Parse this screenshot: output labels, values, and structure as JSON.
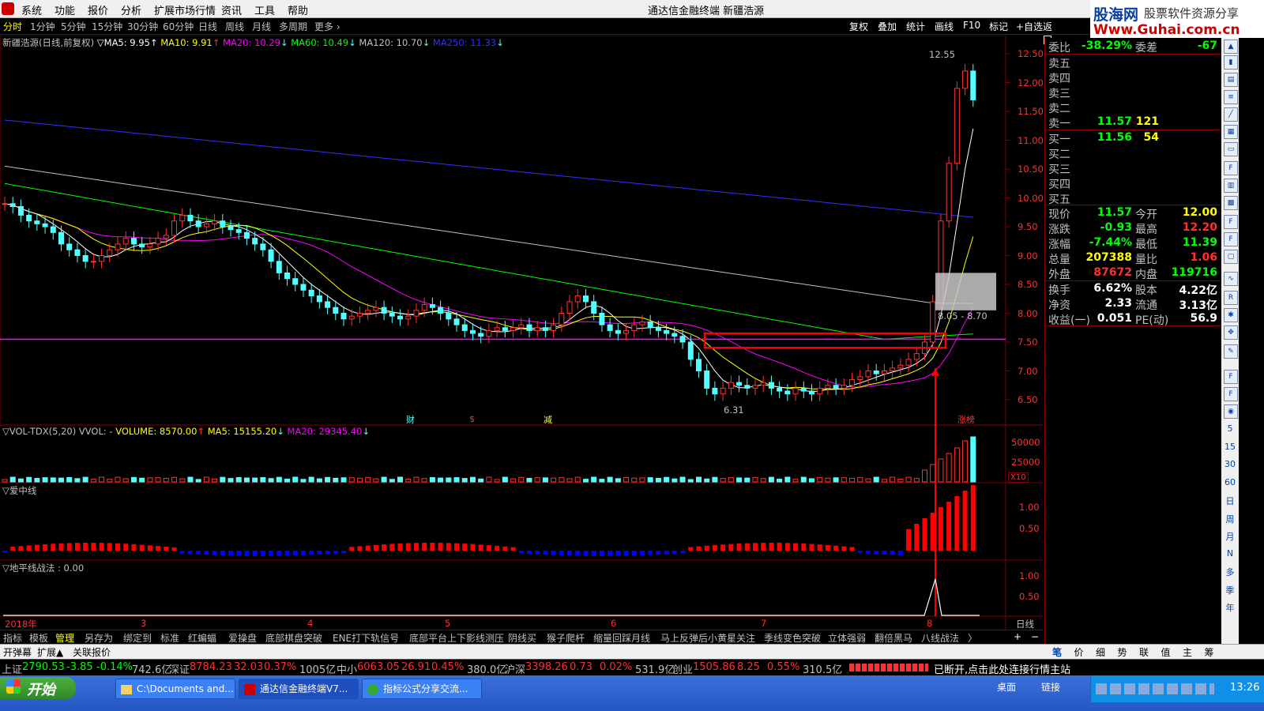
{
  "menu": {
    "items": [
      "系统",
      "功能",
      "报价",
      "分析",
      "扩展市场行情",
      "资讯",
      "工具",
      "帮助"
    ],
    "title": "通达信金融终端 新疆浩源"
  },
  "brand": {
    "name": "股海网",
    "slogan": "股票软件资源分享",
    "url": "Www.Guhai.com.cn"
  },
  "periods": [
    "分时",
    "1分钟",
    "5分钟",
    "15分钟",
    "30分钟",
    "60分钟",
    "日线",
    "周线",
    "月线",
    "多周期",
    "更多 ›"
  ],
  "right_buttons": [
    "复权",
    "叠加",
    "统计",
    "画线",
    "F10",
    "标记",
    "+自选",
    "返回"
  ],
  "main_legend": {
    "title": "新疆浩源(日线,前复权)",
    "ma5": "▽MA5: 9.95",
    "ma10": "MA10: 9.91",
    "ma20": "MA20: 10.29",
    "ma60": "MA60: 10.49",
    "ma120": "MA120: 10.70",
    "ma250": "MA250: 11.33"
  },
  "price_axis": [
    "12.50",
    "12.00",
    "11.50",
    "11.00",
    "10.50",
    "10.00",
    "9.50",
    "9.00",
    "8.50",
    "8.00",
    "7.50",
    "7.00",
    "6.50"
  ],
  "annotations": {
    "high": "12.55",
    "low": "6.31",
    "range": "8.05 - 8.70",
    "marks": [
      "财",
      "$",
      "减",
      "涨榜"
    ]
  },
  "vol_legend": {
    "name": "▽VOL-TDX(5,20)",
    "vvol": "VVOL: -",
    "volume": "VOLUME: 8570.00",
    "ma5": "MA5: 15155.20",
    "ma20": "MA20: 29345.40"
  },
  "vol_axis": [
    "50000",
    "25000"
  ],
  "vol_unit": "X10",
  "ind1": {
    "name": "▽爱中线",
    "axis": [
      "1.00",
      "0.50"
    ]
  },
  "ind2": {
    "name": "▽地平线战法 : 0.00",
    "axis": [
      "1.00",
      "0.50"
    ]
  },
  "date_axis": {
    "labels": [
      "2018年",
      "3",
      "4",
      "5",
      "6",
      "7",
      "8"
    ],
    "right": "日线"
  },
  "panel": {
    "weibi": {
      "label": "委比",
      "value": "-38.29%",
      "label2": "委差",
      "value2": "-67"
    },
    "sell": [
      {
        "label": "卖五"
      },
      {
        "label": "卖四"
      },
      {
        "label": "卖三"
      },
      {
        "label": "卖二"
      },
      {
        "label": "卖一",
        "price": "11.57",
        "vol": "121"
      }
    ],
    "buy": [
      {
        "label": "买一",
        "price": "11.56",
        "vol": "54"
      },
      {
        "label": "买二"
      },
      {
        "label": "买三"
      },
      {
        "label": "买四"
      },
      {
        "label": "买五"
      }
    ],
    "quote": [
      {
        "l1": "现价",
        "v1": "11.57",
        "l2": "今开",
        "v2": "12.00"
      },
      {
        "l1": "涨跌",
        "v1": "-0.93",
        "l2": "最高",
        "v2": "12.20"
      },
      {
        "l1": "涨幅",
        "v1": "-7.44%",
        "l2": "最低",
        "v2": "11.39"
      },
      {
        "l1": "总量",
        "v1": "207388",
        "l2": "量比",
        "v2": "1.06"
      },
      {
        "l1": "外盘",
        "v1": "87672",
        "l2": "内盘",
        "v2": "119716"
      }
    ],
    "fund": [
      {
        "l1": "换手",
        "v1": "6.62%",
        "l2": "股本",
        "v2": "4.22亿"
      },
      {
        "l1": "净资",
        "v1": "2.33",
        "l2": "流通",
        "v2": "3.13亿"
      },
      {
        "l1": "收益(一)",
        "v1": "0.051",
        "l2": "PE(动)",
        "v2": "56.9"
      }
    ],
    "buttons": [
      "笔",
      "价",
      "细",
      "势",
      "联",
      "值",
      "主",
      "筹"
    ]
  },
  "tools": {
    "labels": [
      "5",
      "15",
      "30",
      "60",
      "日",
      "周",
      "月",
      "N",
      "多",
      "季",
      "年"
    ]
  },
  "indicator_tabs": [
    "指标",
    "模板",
    "管理",
    "另存为",
    "绑定到",
    "标准",
    "红蝙蝠",
    "爱操盘",
    "底部棋盘突破",
    "ENE打下轨信号",
    "底部平台上下影线测压",
    "阴线买",
    "猴子爬杆",
    "缩量回踩月线",
    "马上反弹后小黄星关注",
    "季线变色突破",
    "立体强弱",
    "翻倍黑马",
    "八线战法",
    "〉"
  ],
  "sub_tabs": [
    "开弹幕",
    "扩展▲",
    "关联报价"
  ],
  "ticker": [
    {
      "name": "上证",
      "val": "2790.53",
      "chg": "-3.85",
      "pct": "-0.14%",
      "amt": "742.6亿"
    },
    {
      "name": "深证",
      "val": "8784.23",
      "chg": "32.03",
      "pct": "0.37%",
      "amt": "1005亿"
    },
    {
      "name": "中小",
      "val": "6063.05",
      "chg": "26.91",
      "pct": "0.45%",
      "amt": "380.0亿"
    },
    {
      "name": "沪深",
      "val": "3398.26",
      "chg": "0.73",
      "pct": "0.02%",
      "amt": "531.9亿"
    },
    {
      "name": "创业",
      "val": "1505.86",
      "chg": "8.25",
      "pct": "0.55%",
      "amt": "310.5亿"
    }
  ],
  "status": "已断开,点击此处连接行情主站",
  "taskbar": {
    "start": "开始",
    "tasks": [
      "C:\\Documents and...",
      "通达信金融终端V7...",
      "指标公式分享交流..."
    ],
    "desktop": "桌面",
    "links": "链接",
    "time": "13:26"
  },
  "colors": {
    "up": "#ff3232",
    "down": "#54ffff",
    "ma5": "#ffffff",
    "ma10": "#ffff00",
    "ma20": "#ff00ff",
    "ma60": "#00ff00",
    "ma120": "#c0c0c0",
    "ma250": "#3030ff",
    "support": "#ff00ff"
  }
}
